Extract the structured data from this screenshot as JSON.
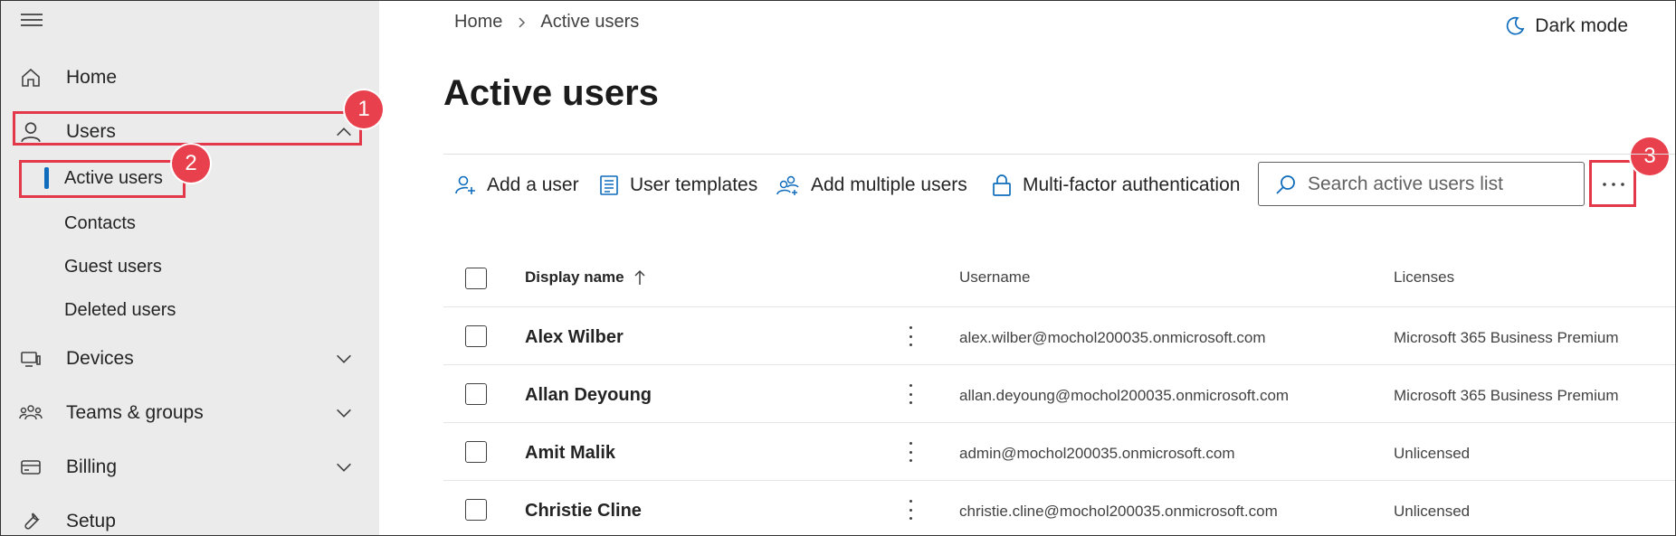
{
  "sidebar": {
    "items": [
      {
        "label": "Home",
        "icon": "home-icon"
      },
      {
        "label": "Users",
        "icon": "user-icon"
      },
      {
        "label": "Devices",
        "icon": "devices-icon"
      },
      {
        "label": "Teams & groups",
        "icon": "teams-icon"
      },
      {
        "label": "Billing",
        "icon": "billing-icon"
      },
      {
        "label": "Setup",
        "icon": "wrench-icon"
      }
    ],
    "users_subitems": [
      "Active users",
      "Contacts",
      "Guest users",
      "Deleted users"
    ]
  },
  "header": {
    "breadcrumb": [
      "Home",
      "Active users"
    ],
    "dark_mode_label": "Dark mode",
    "title": "Active users"
  },
  "toolbar": {
    "add_user": "Add a user",
    "user_templates": "User templates",
    "add_multiple": "Add multiple users",
    "mfa": "Multi-factor authentication",
    "search_placeholder": "Search active users list"
  },
  "callouts": [
    "1",
    "2",
    "3"
  ],
  "table": {
    "columns": [
      "Display name",
      "Username",
      "Licenses"
    ],
    "rows": [
      {
        "name": "Alex Wilber",
        "username": "alex.wilber@mochol200035.onmicrosoft.com",
        "license": "Microsoft 365 Business Premium"
      },
      {
        "name": "Allan Deyoung",
        "username": "allan.deyoung@mochol200035.onmicrosoft.com",
        "license": "Microsoft 365 Business Premium"
      },
      {
        "name": "Amit Malik",
        "username": "admin@mochol200035.onmicrosoft.com",
        "license": "Unlicensed"
      },
      {
        "name": "Christie Cline",
        "username": "christie.cline@mochol200035.onmicrosoft.com",
        "license": "Unlicensed"
      }
    ]
  },
  "colors": {
    "accent": "#0f6cbd",
    "callout": "#e8414d",
    "sidebar_bg": "#ebebeb"
  }
}
